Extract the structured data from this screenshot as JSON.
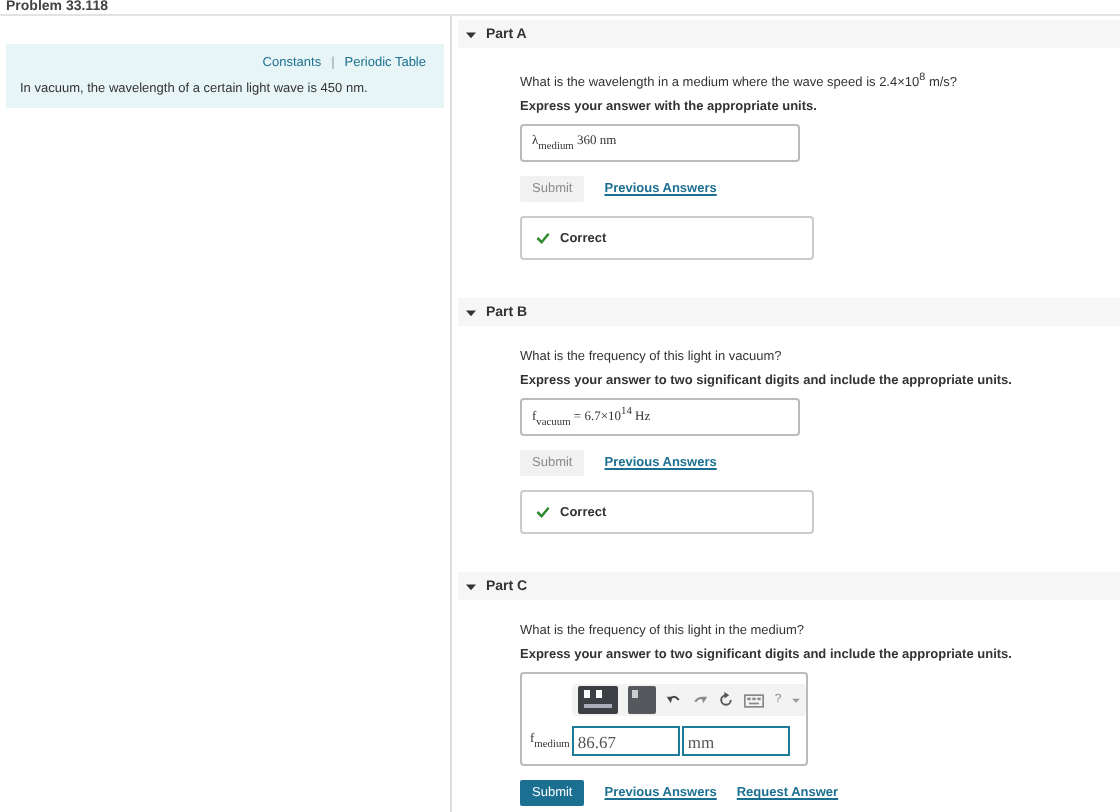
{
  "problem_title": "Problem 33.118",
  "info_links": [
    "Constants",
    "Periodic Table"
  ],
  "info_separator": "|",
  "info_text": "In vacuum, the wavelength of a certain light wave is 450 nm.",
  "parts": [
    {
      "label": "Part A",
      "expanded": true,
      "question": "What is the wavelength in a medium where the wave speed is 2.4×10$^{8}$ m/s?",
      "instruction": "Express your answer with the appropriate units.",
      "kind": "answered",
      "answer": "λ$_{medium}$ 360 nm",
      "submit": {
        "label": "Submit",
        "disabled": true
      },
      "links": [
        "Previous Answers"
      ],
      "feedback": "Correct"
    },
    {
      "label": "Part B",
      "expanded": true,
      "question": "What is the frequency of this light in vacuum?",
      "instruction": "Express your answer to two significant digits and include the appropriate units.",
      "kind": "answered",
      "answer": "f$_{vacuum}$ = 6.7×10$^{14}$ Hz",
      "submit": {
        "label": "Submit",
        "disabled": true
      },
      "links": [
        "Previous Answers"
      ],
      "feedback": "Correct"
    },
    {
      "label": "Part C",
      "expanded": true,
      "question": "What is the frequency of this light in the medium?",
      "instruction": "Express your answer to two significant digits and include the appropriate units.",
      "kind": "entry",
      "variable": "f$_{medium}$",
      "value": "86.67",
      "units": "mm",
      "help": "?",
      "submit": {
        "label": "Submit",
        "disabled": false
      },
      "links": [
        "Previous Answers",
        "Request Answer"
      ]
    }
  ]
}
